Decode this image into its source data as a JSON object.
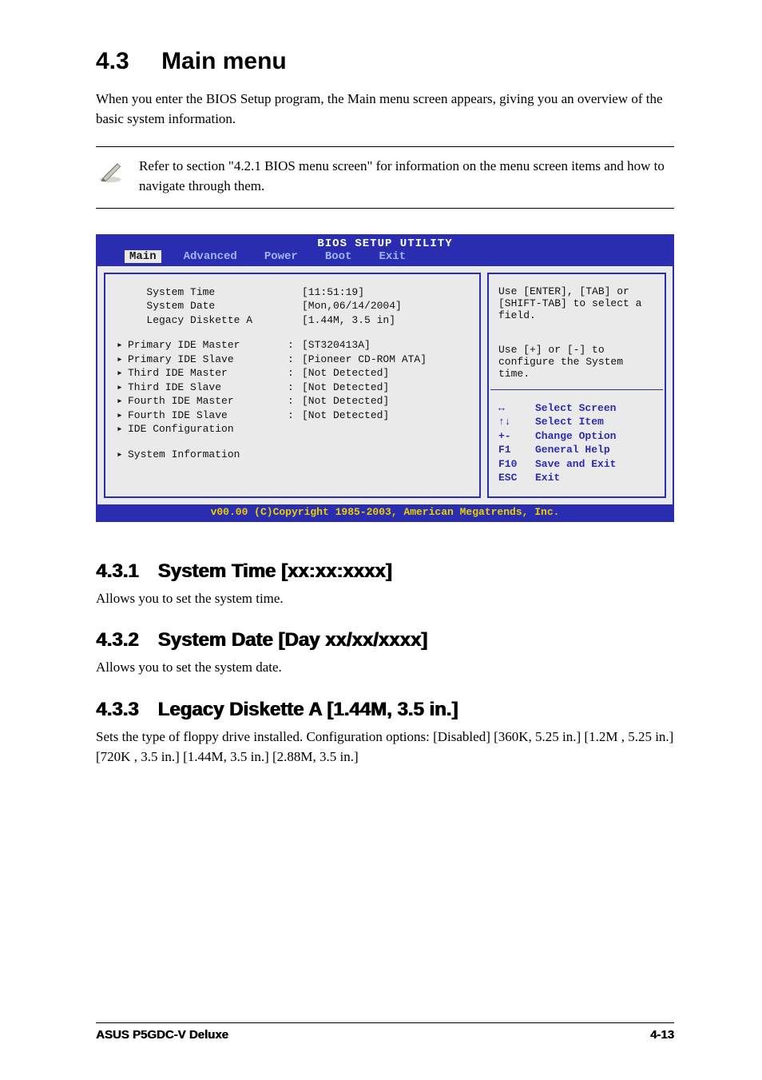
{
  "section": {
    "number": "4.3",
    "title": "Main menu"
  },
  "intro": "When you enter the BIOS Setup program, the Main menu screen appears, giving you an overview of the basic system information.",
  "note": "Refer to section \"4.2.1  BIOS menu screen\" for information on the menu screen items and how to navigate through them.",
  "bios": {
    "title": "BIOS SETUP UTILITY",
    "tabs": [
      "Main",
      "Advanced",
      "Power",
      "Boot",
      "Exit"
    ],
    "selected_tab": "Main",
    "rows_top": [
      {
        "label": "System Time",
        "value": "[11:51:19]"
      },
      {
        "label": "System Date",
        "value": "[Mon,06/14/2004]"
      },
      {
        "label": "Legacy Diskette A",
        "value": "[1.44M, 3.5 in]"
      }
    ],
    "rows_ide": [
      {
        "label": "Primary IDE Master",
        "value": "[ST320413A]"
      },
      {
        "label": "Primary IDE Slave",
        "value": "[Pioneer CD-ROM ATA]"
      },
      {
        "label": "Third IDE Master",
        "value": "[Not Detected]"
      },
      {
        "label": "Third IDE Slave",
        "value": "[Not Detected]"
      },
      {
        "label": "Fourth IDE Master",
        "value": "[Not Detected]"
      },
      {
        "label": "Fourth IDE Slave",
        "value": "[Not Detected]"
      },
      {
        "label": "IDE Configuration",
        "value": ""
      }
    ],
    "rows_bottom": [
      {
        "label": "System Information",
        "value": ""
      }
    ],
    "help1": "Use [ENTER], [TAB] or [SHIFT-TAB] to select a field.",
    "help2": "Use [+] or [-] to configure the System time.",
    "nav": [
      {
        "key": "↔",
        "label": "Select Screen"
      },
      {
        "key": "↑↓",
        "label": "Select Item"
      },
      {
        "key": "+-",
        "label": "Change Option"
      },
      {
        "key": "F1",
        "label": "General Help"
      },
      {
        "key": "F10",
        "label": "Save and Exit"
      },
      {
        "key": "ESC",
        "label": "Exit"
      }
    ],
    "copyright": "v00.00 (C)Copyright 1985-2003, American Megatrends, Inc."
  },
  "subs": [
    {
      "no": "4.3.1",
      "title": "System Time [xx:xx:xxxx]",
      "body": "Allows you to set the system time."
    },
    {
      "no": "4.3.2",
      "title": "System Date [Day xx/xx/xxxx]",
      "body": "Allows you to set the system date."
    },
    {
      "no": "4.3.3",
      "title": "Legacy Diskette A [1.44M, 3.5 in.]",
      "body": "Sets the type of floppy drive installed. Configuration options: [Disabled] [360K, 5.25 in.] [1.2M , 5.25 in.] [720K , 3.5 in.] [1.44M, 3.5 in.] [2.88M, 3.5 in.]"
    }
  ],
  "footer": {
    "left": "ASUS P5GDC-V Deluxe",
    "right": "4-13"
  }
}
